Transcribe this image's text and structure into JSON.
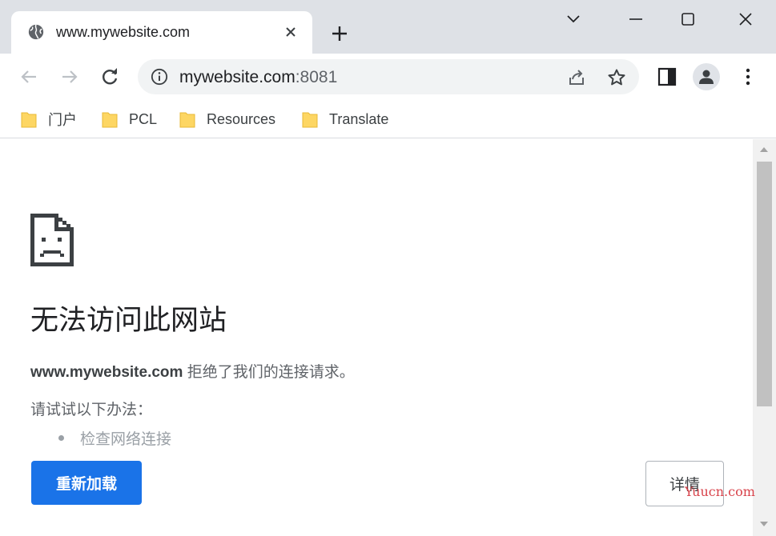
{
  "tab": {
    "title": "www.mywebsite.com",
    "close_icon": "close-icon"
  },
  "window": {
    "new_tab_icon": "plus-icon",
    "tab_search_icon": "chevron-down-icon",
    "minimize_icon": "minimize-icon",
    "maximize_icon": "maximize-icon",
    "close_icon": "close-icon"
  },
  "toolbar": {
    "back_icon": "arrow-left-icon",
    "forward_icon": "arrow-right-icon",
    "reload_icon": "reload-icon",
    "site_info_icon": "info-icon",
    "url_host": "mywebsite.com",
    "url_port": ":8081",
    "share_icon": "share-icon",
    "bookmark_icon": "star-icon",
    "side_panel_icon": "side-panel-icon",
    "profile_icon": "person-icon",
    "menu_icon": "kebab-menu-icon"
  },
  "bookmarks": [
    {
      "label": "门户",
      "icon": "folder-icon"
    },
    {
      "label": "PCL",
      "icon": "folder-icon"
    },
    {
      "label": "Resources",
      "icon": "folder-icon"
    },
    {
      "label": "Translate",
      "icon": "folder-icon"
    }
  ],
  "error": {
    "icon": "sad-page-icon",
    "heading": "无法访问此网站",
    "host": "www.mywebsite.com",
    "message_rest": " 拒绝了我们的连接请求。",
    "try_label": "请试试以下办法：",
    "suggestions": [
      "检查网络连接"
    ],
    "reload_label": "重新加载",
    "details_label": "详情"
  },
  "watermark": "Yuucn.com",
  "colors": {
    "tabstrip": "#dee1e6",
    "omnibox": "#f1f3f4",
    "primary_button": "#1a73e8",
    "folder": "#fdd663",
    "watermark": "#d8424a"
  }
}
